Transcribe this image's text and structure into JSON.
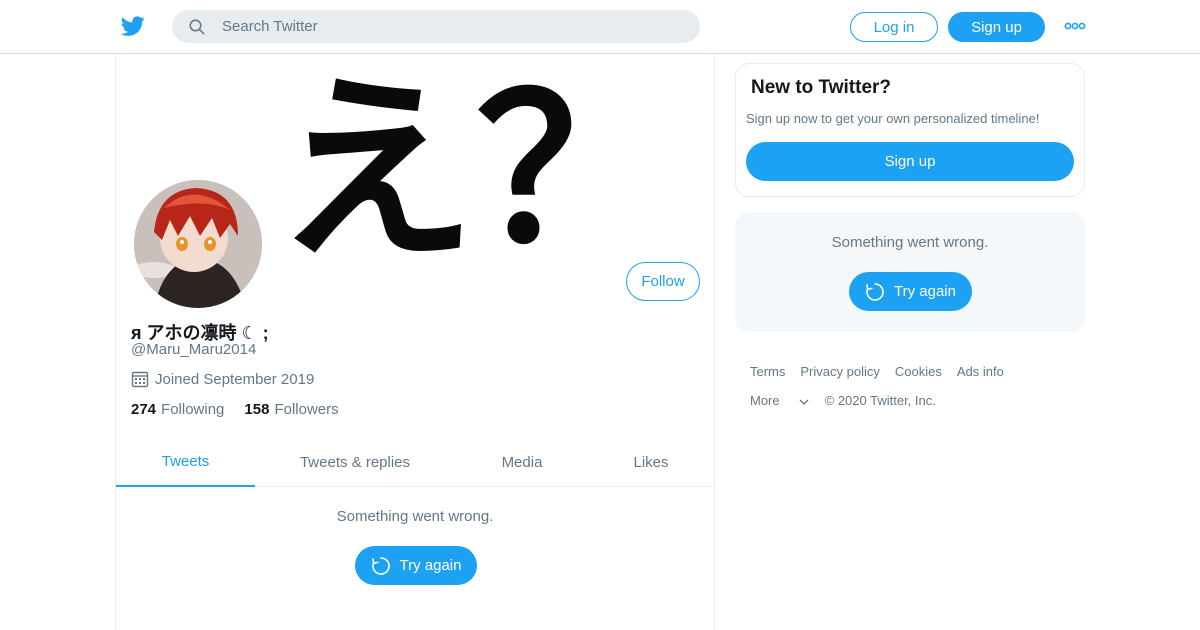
{
  "header": {
    "search_placeholder": "Search Twitter",
    "login_label": "Log in",
    "signup_label": "Sign up",
    "brand_color": "#1da1f2"
  },
  "profile": {
    "banner_text": "え？",
    "display_name": "я アホの凛時 ☾ ;",
    "handle": "@Maru_Maru2014",
    "joined": "Joined September 2019",
    "following_count": "274",
    "following_label": "Following",
    "followers_count": "158",
    "followers_label": "Followers",
    "follow_label": "Follow"
  },
  "tabs": [
    {
      "label": "Tweets",
      "active": true
    },
    {
      "label": "Tweets & replies",
      "active": false
    },
    {
      "label": "Media",
      "active": false
    },
    {
      "label": "Likes",
      "active": false
    }
  ],
  "timeline": {
    "error": "Something went wrong.",
    "retry": "Try again"
  },
  "sidebar": {
    "signup_card": {
      "title": "New to Twitter?",
      "text": "Sign up now to get your own personalized timeline!",
      "button": "Sign up"
    },
    "error_card": {
      "error": "Something went wrong.",
      "retry": "Try again"
    },
    "footer": {
      "links": [
        "Terms",
        "Privacy policy",
        "Cookies",
        "Ads info"
      ],
      "more": "More",
      "copyright": "© 2020 Twitter, Inc."
    }
  }
}
